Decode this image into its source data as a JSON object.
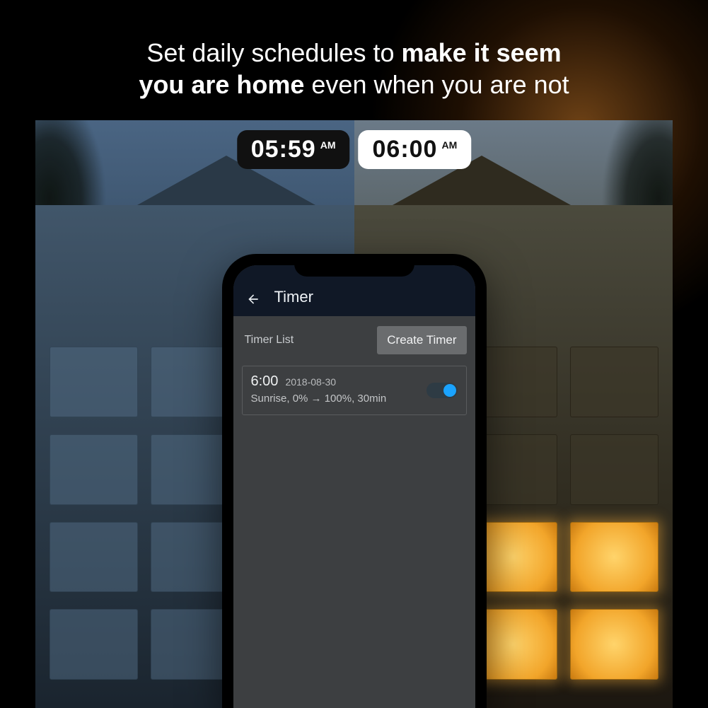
{
  "headline": {
    "part1": "Set daily schedules to ",
    "bold1": "make it seem",
    "part2": " ",
    "bold2": "you are home",
    "part3": " even when you are not"
  },
  "time_pills": {
    "left_time": "05:59",
    "left_ampm": "AM",
    "right_time": "06:00",
    "right_ampm": "AM"
  },
  "app": {
    "title": "Timer",
    "list_label": "Timer List",
    "create_button": "Create Timer",
    "timer": {
      "time": "6:00",
      "date": "2018-08-30",
      "desc": "Sunrise, 0% → 100%, 30min",
      "enabled": true
    }
  },
  "colors": {
    "accent": "#1aa3ff",
    "app_header_bg": "#101826",
    "screen_bg": "#3d3f41"
  }
}
